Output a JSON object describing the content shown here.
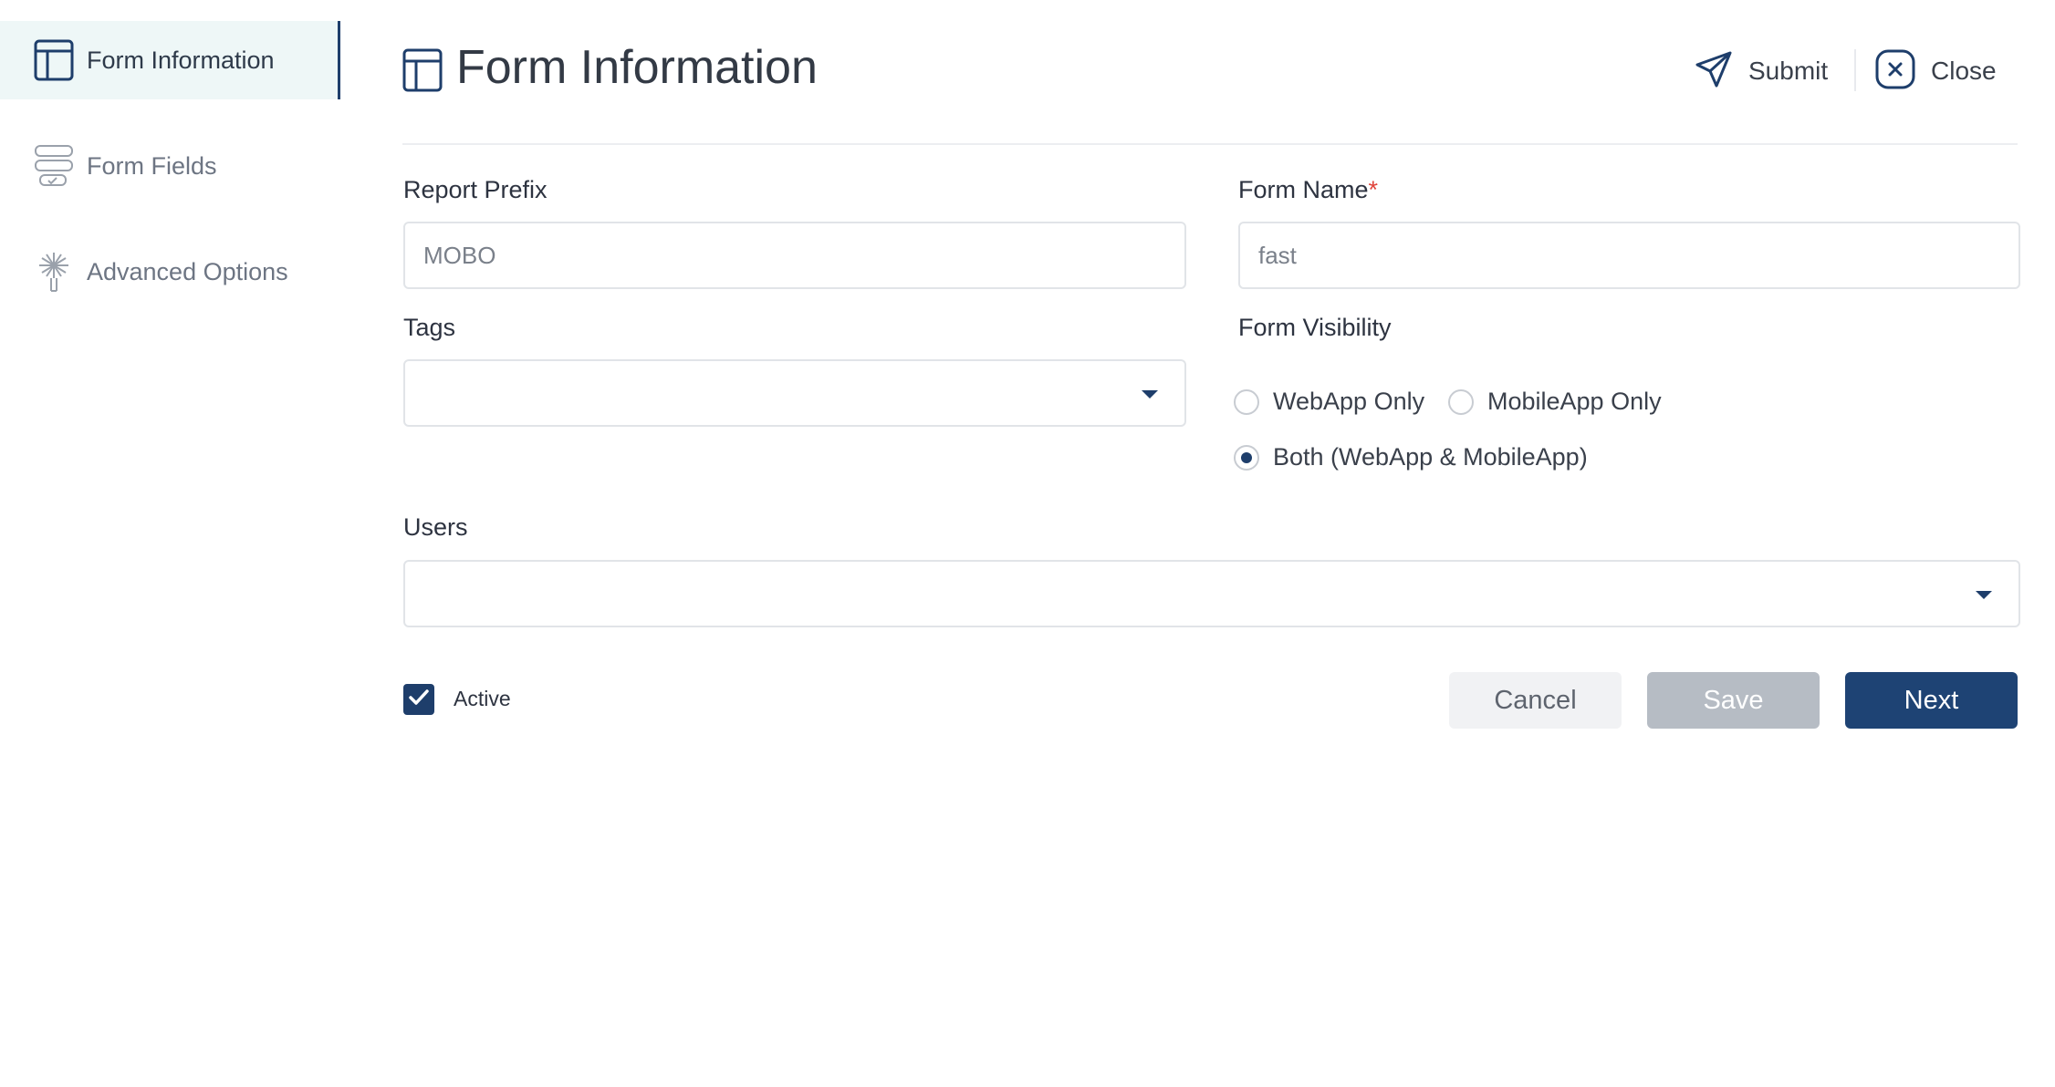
{
  "sidebar": {
    "items": [
      {
        "label": "Form Information",
        "icon": "layout-icon",
        "active": true
      },
      {
        "label": "Form Fields",
        "icon": "form-fields-icon",
        "active": false
      },
      {
        "label": "Advanced Options",
        "icon": "advanced-options-icon",
        "active": false
      }
    ]
  },
  "header": {
    "title": "Form Information",
    "submit_label": "Submit",
    "close_label": "Close"
  },
  "form": {
    "report_prefix": {
      "label": "Report Prefix",
      "value": "MOBO"
    },
    "form_name": {
      "label": "Form Name",
      "required_mark": "*",
      "value": "fast"
    },
    "tags": {
      "label": "Tags",
      "value": ""
    },
    "visibility": {
      "label": "Form Visibility",
      "options": [
        {
          "label": "WebApp Only",
          "checked": false
        },
        {
          "label": "MobileApp Only",
          "checked": false
        },
        {
          "label": "Both (WebApp & MobileApp)",
          "checked": true
        }
      ]
    },
    "users": {
      "label": "Users",
      "value": ""
    },
    "active": {
      "label": "Active",
      "checked": true
    }
  },
  "actions": {
    "cancel_label": "Cancel",
    "save_label": "Save",
    "next_label": "Next"
  },
  "colors": {
    "accent": "#1e4374",
    "active_bg": "#eef7f7",
    "required": "#e0443b"
  }
}
